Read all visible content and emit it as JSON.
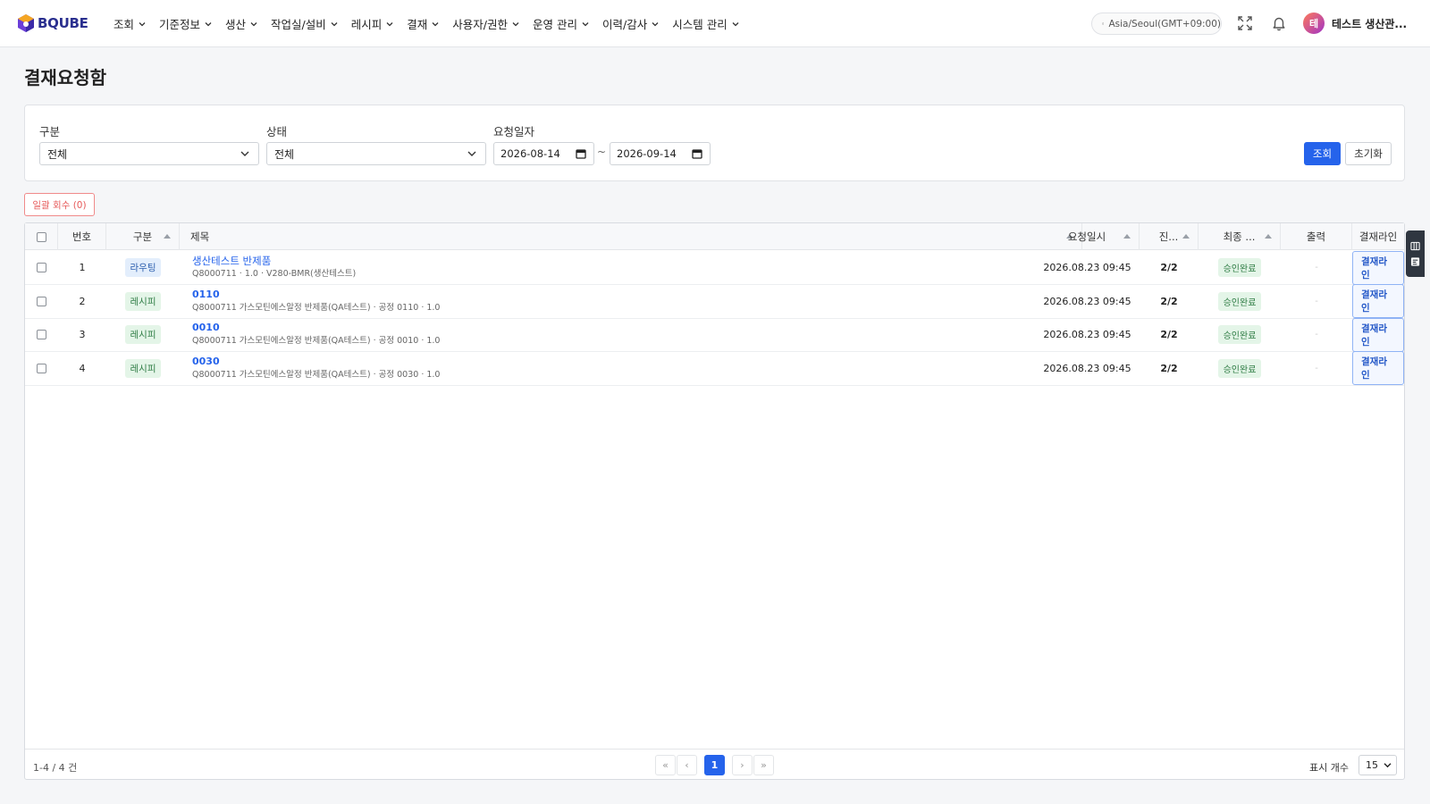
{
  "app": {
    "logo_text": "BQUBE",
    "brand_color": "#2a2f8f"
  },
  "nav": [
    {
      "label": "조회"
    },
    {
      "label": "기준정보"
    },
    {
      "label": "생산"
    },
    {
      "label": "작업실/설비"
    },
    {
      "label": "레시피"
    },
    {
      "label": "결재"
    },
    {
      "label": "사용자/권한"
    },
    {
      "label": "운영 관리"
    },
    {
      "label": "이력/감사"
    },
    {
      "label": "시스템 관리"
    }
  ],
  "header": {
    "timezone": "Asia/Seoul(GMT+09:00)",
    "avatar_initial": "테",
    "user_name": "테스트 생산관...",
    "icons": [
      "clock-icon",
      "fullscreen-icon",
      "bell-icon"
    ]
  },
  "page": {
    "title": "결재요청함"
  },
  "filters": {
    "category_label": "구분",
    "category_value": "전체",
    "status_label": "상태",
    "status_value": "전체",
    "date_label": "요청일자",
    "date_from": "2026-08-14",
    "date_to": "2026-09-14",
    "tilde": "~",
    "search_label": "조회",
    "reset_label": "초기화",
    "accent_color": "#2563eb"
  },
  "actions": {
    "bulk_recall_label": "일괄 회수 (0)"
  },
  "table": {
    "columns": [
      "번호",
      "구분",
      "제목",
      "요청일시",
      "진...",
      "최종 ...",
      "출력",
      "결재라인"
    ],
    "rows": [
      {
        "no": "1",
        "type": "라우팅",
        "type_color": "blue",
        "title": "생산테스트 반제품",
        "title_bold": false,
        "subtitle": "Q8000711 · 1.0 · V280-BMR(생산테스트)",
        "requested_at": "2026.08.23 09:45",
        "progress": "2/2",
        "final_status": "승인완료",
        "print": "-",
        "line_button": "결재라인"
      },
      {
        "no": "2",
        "type": "레시피",
        "type_color": "green",
        "title": "0110",
        "title_bold": true,
        "subtitle": "Q8000711 가스모틴에스알정 반제품(QA테스트) · 공정 0110 · 1.0",
        "requested_at": "2026.08.23 09:45",
        "progress": "2/2",
        "final_status": "승인완료",
        "print": "-",
        "line_button": "결재라인"
      },
      {
        "no": "3",
        "type": "레시피",
        "type_color": "green",
        "title": "0010",
        "title_bold": true,
        "subtitle": "Q8000711 가스모틴에스알정 반제품(QA테스트) · 공정 0010 · 1.0",
        "requested_at": "2026.08.23 09:45",
        "progress": "2/2",
        "final_status": "승인완료",
        "print": "-",
        "line_button": "결재라인"
      },
      {
        "no": "4",
        "type": "레시피",
        "type_color": "green",
        "title": "0030",
        "title_bold": true,
        "subtitle": "Q8000711 가스모틴에스알정 반제품(QA테스트) · 공정 0030 · 1.0",
        "requested_at": "2026.08.23 09:45",
        "progress": "2/2",
        "final_status": "승인완료",
        "print": "-",
        "line_button": "결재라인"
      }
    ]
  },
  "pagination": {
    "summary": "1-4 / 4 건",
    "first": "«",
    "prev": "‹",
    "current": "1",
    "next": "›",
    "last": "»",
    "page_size_label": "표시 개수",
    "page_size_value": "15"
  }
}
